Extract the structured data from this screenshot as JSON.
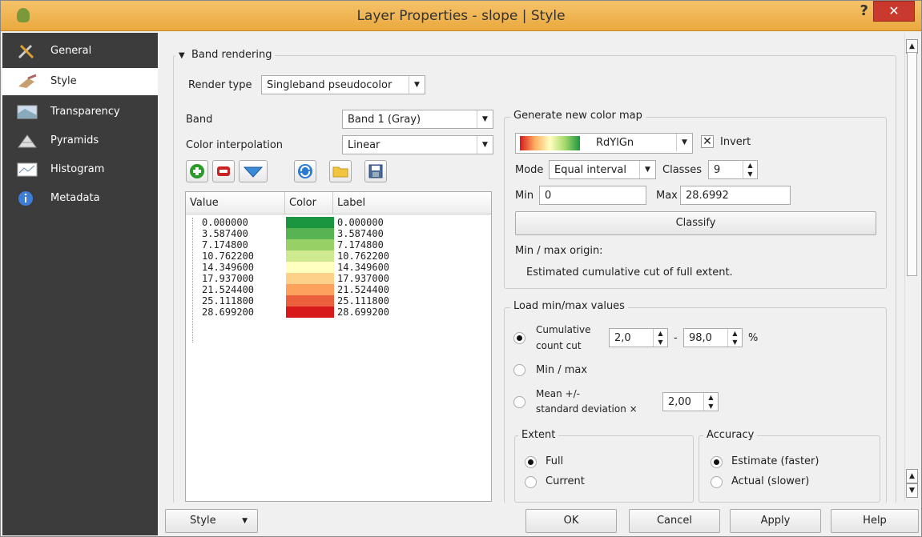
{
  "window": {
    "title": "Layer Properties - slope | Style",
    "help_label": "?",
    "close_label": "✕"
  },
  "sidebar": {
    "items": [
      {
        "label": "General",
        "icon": "tools-icon"
      },
      {
        "label": "Style",
        "icon": "style-brush-icon"
      },
      {
        "label": "Transparency",
        "icon": "transparency-icon"
      },
      {
        "label": "Pyramids",
        "icon": "pyramids-icon"
      },
      {
        "label": "Histogram",
        "icon": "histogram-icon"
      },
      {
        "label": "Metadata",
        "icon": "info-icon"
      }
    ]
  },
  "band_rendering": {
    "header": "Band rendering",
    "render_type_label": "Render type",
    "render_type_value": "Singleband pseudocolor",
    "band_label": "Band",
    "band_value": "Band 1 (Gray)",
    "interp_label": "Color interpolation",
    "interp_value": "Linear"
  },
  "table": {
    "headers": [
      "Value",
      "Color",
      "Label"
    ],
    "rows": [
      {
        "value": "0.000000",
        "color": "#1a9641",
        "label": "0.000000"
      },
      {
        "value": "3.587400",
        "color": "#58b453",
        "label": "3.587400"
      },
      {
        "value": "7.174800",
        "color": "#97d065",
        "label": "7.174800"
      },
      {
        "value": "10.762200",
        "color": "#cfe991",
        "label": "10.762200"
      },
      {
        "value": "14.349600",
        "color": "#ffffc0",
        "label": "14.349600"
      },
      {
        "value": "17.937000",
        "color": "#fed18b",
        "label": "17.937000"
      },
      {
        "value": "21.524400",
        "color": "#fca25c",
        "label": "21.524400"
      },
      {
        "value": "25.111800",
        "color": "#eb5f3c",
        "label": "25.111800"
      },
      {
        "value": "28.699200",
        "color": "#d7191c",
        "label": "28.699200"
      }
    ]
  },
  "colormap": {
    "header": "Generate new color map",
    "ramp_name": "RdYlGn",
    "invert_label": "Invert",
    "invert_mark": "✕",
    "mode_label": "Mode",
    "mode_value": "Equal interval",
    "classes_label": "Classes",
    "classes_value": "9",
    "min_label": "Min",
    "min_value": "0",
    "max_label": "Max",
    "max_value": "28.6992",
    "classify_label": "Classify",
    "origin_label": "Min / max origin:",
    "origin_value": "Estimated cumulative cut of full extent."
  },
  "minmax": {
    "header": "Load min/max values",
    "cumulative_label_1": "Cumulative",
    "cumulative_label_2": "count cut",
    "cut_low": "2,0",
    "dash": "-",
    "cut_high": "98,0",
    "percent": "%",
    "minmax_label": "Min / max",
    "mean_label_1": "Mean +/-",
    "mean_label_2": "standard deviation ×",
    "stddev_value": "2,00",
    "extent_header": "Extent",
    "extent_full": "Full",
    "extent_current": "Current",
    "accuracy_header": "Accuracy",
    "accuracy_estimate": "Estimate (faster)",
    "accuracy_actual": "Actual (slower)"
  },
  "buttons": {
    "style": "Style",
    "ok": "OK",
    "cancel": "Cancel",
    "apply": "Apply",
    "help": "Help"
  },
  "colors": {
    "sidebar_bg": "#3c3c3c",
    "title_bar": "#eaa93e",
    "close_button": "#c9392e"
  }
}
